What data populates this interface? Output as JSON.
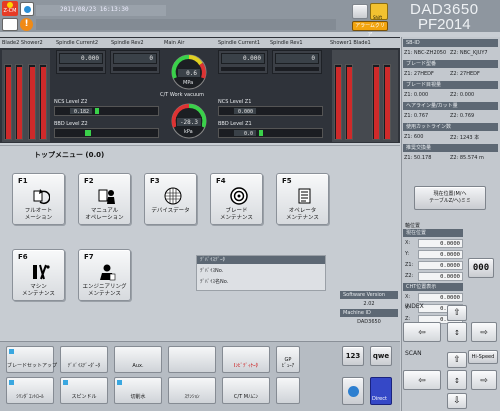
{
  "header": {
    "datetime": "2011/08/23 16:13:30",
    "logo": "DAD3650",
    "model": "PF2014",
    "alarm_clear": "アラームクリア",
    "shift_label": "Shift",
    "badge_left": "Z-CM"
  },
  "gauges": {
    "headers": [
      "Blade2 Shower2",
      "Spindle Current2",
      "Spindle Rev2",
      "Main Air",
      "Spindle Current1",
      "Spindle Rev1",
      "Shower1 Blade1"
    ],
    "current2": "0.000",
    "rev2": "0",
    "current1": "0.000",
    "rev1": "0",
    "main_air": "0.6",
    "air_unit": "MPa",
    "ct_vacuum_label": "C/T Work vacuum",
    "ct_vacuum": "-28.3",
    "ct_unit": "kPa",
    "ncs2_label": "NCS Level Z2",
    "ncs2": "0.182",
    "ncs1_label": "NCS Level Z1",
    "ncs1": "0.000",
    "bbd2_label": "BBD Level Z2",
    "bbd1_label": "BBD Level Z1",
    "bbd1_val": "0.0"
  },
  "menu": {
    "title": "トップメニュー (0.0)",
    "tiles": [
      {
        "key": "F1",
        "label": "フルオート\nメーション"
      },
      {
        "key": "F2",
        "label": "マニュアル\nオペレーション"
      },
      {
        "key": "F3",
        "label": "デバイスデータ"
      },
      {
        "key": "F4",
        "label": "ブレード\nメンテナンス"
      },
      {
        "key": "F5",
        "label": "オペレータ\nメンテナンス"
      },
      {
        "key": "F6",
        "label": "マシン\nメンテナンス"
      },
      {
        "key": "F7",
        "label": "エンジニアリング\nメンテナンス"
      }
    ]
  },
  "device_info": {
    "rows": [
      "ﾃﾞﾊﾞｲｽﾃﾞｰﾀ",
      "ﾃﾞﾊﾞｲｽNo.",
      "ﾃﾞﾊﾞｲｽ名No."
    ],
    "sw_label": "Software Version",
    "sw_value": "2.02",
    "machine_label": "Machine ID",
    "machine_value": "DAD3650"
  },
  "right": {
    "ok_label": "SB-ID",
    "z1": "Z1: NBC-ZH2050",
    "z2": "Z2: NBC_KJUY7",
    "blade_label": "ブレード型番",
    "z1b": "Z1: 27HEDF",
    "z2b": "Z2: 27HEDF",
    "cut_label": "ブレード目視量",
    "zz1": "Z1: 0.000",
    "zz2": "Z2: 0.000",
    "hairline": "ヘアライン量/カット量",
    "h1": "Z1: 0.767",
    "h2": "Z2: 0.769",
    "count_label": "使用カットライン数",
    "c1": "Z1: 600",
    "c2": "Z2: 1243 本",
    "life_label": "推奨交換量",
    "l1": "Z1: 50.178",
    "l2": "Z2: 85.574 m",
    "blade_btn": "現在位置(M/ヘ\nテーブルZ/ヘ)ミミ",
    "pos_title": "軸位置",
    "cur_pos": "現在位置",
    "x": "0.0000",
    "y": "0.0000",
    "z1v": "0.0000",
    "z2v": "0.0000",
    "cut_pos": "CHT位置表示",
    "cx": "0.0000",
    "cy": "0.0000",
    "cz": "0.0000",
    "counter": "000",
    "index_label": "INDEX",
    "scan_label": "SCAN",
    "hispeed": "Hi-Speed"
  },
  "softkeys": [
    "ブレードセットアップ",
    "ﾃﾞﾊﾞｲｽﾃﾞｰﾀﾞｰﾀ",
    "Aux.",
    "",
    "Iﾝﾋﾞﾃﾞｨｹｰﾀ",
    "GP\nﾋﾞｭｰｱ",
    "ｼﾘﾝﾀﾞｺﾝﾄﾛｰﾙ",
    "スピンドル",
    "切削水",
    "ｽﾃﾝｼｮﾝ",
    "C/T Mﾉﾑﾆﾝ",
    ""
  ],
  "keys": {
    "num": "123",
    "qwe": "qwe",
    "direct": "Direct"
  }
}
